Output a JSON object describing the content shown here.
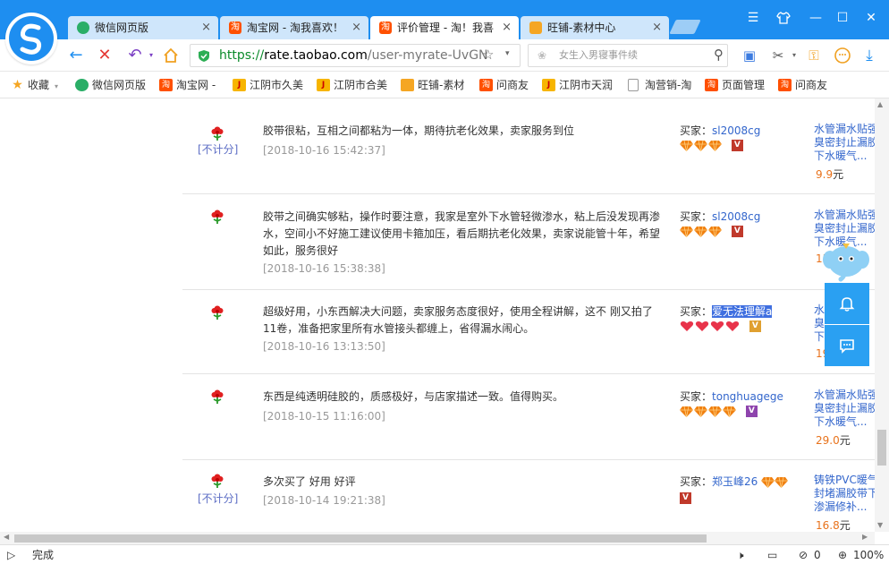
{
  "tabs": [
    {
      "title": "微信网页版",
      "icon": "wechat-icon",
      "close": "×"
    },
    {
      "title": "淘宝网 - 淘我喜欢！",
      "icon": "taobao-icon",
      "close": "×"
    },
    {
      "title": "评价管理 - 淘！我喜",
      "icon": "taobao-icon",
      "close": "×",
      "active": true
    },
    {
      "title": "旺铺-素材中心",
      "icon": "wangpu-icon",
      "close": "×"
    }
  ],
  "address": {
    "url_scheme": "https://",
    "url_host": "rate.taobao.com",
    "url_path": "/user-myrate-UvGN",
    "search_placeholder": "女生入男寝事件续"
  },
  "bookmarks": [
    {
      "label": "收藏",
      "icon": "star-icon"
    },
    {
      "label": "微信网页版",
      "icon": "wechat-icon"
    },
    {
      "label": "淘宝网 -",
      "icon": "taobao-icon"
    },
    {
      "label": "江阴市久美",
      "icon": "jiangyin-icon"
    },
    {
      "label": "江阴市合美",
      "icon": "jiangyin-icon"
    },
    {
      "label": "旺铺-素材",
      "icon": "wangpu-icon"
    },
    {
      "label": "问商友",
      "icon": "taobao-icon"
    },
    {
      "label": "江阴市天润",
      "icon": "jiangyin-icon"
    },
    {
      "label": "淘营销-淘",
      "icon": "page-icon"
    },
    {
      "label": "页面管理",
      "icon": "taobao-icon"
    },
    {
      "label": "问商友",
      "icon": "taobao-icon"
    }
  ],
  "reviews": [
    {
      "nocount": "[不计分]",
      "text": "胶带很粘，互相之间都粘为一体，期待抗老化效果，卖家服务到位",
      "date": "[2018-10-16 15:42:37]",
      "buyer_label": "买家：",
      "buyer_name": "sl2008cg",
      "item_lines": [
        "水管漏水贴强",
        "臭密封止漏胶",
        "下水暖气..."
      ],
      "price": "9.9",
      "price_unit": "元"
    },
    {
      "nocount": "",
      "text": "胶带之间确实够粘，操作时要注意，我家是室外下水管轻微渗水，粘上后没发现再渗水，空间小不好施工建议使用卡箍加压，看后期抗老化效果，卖家说能管十年，希望如此，服务很好",
      "date": "[2018-10-16 15:38:38]",
      "buyer_label": "买家：",
      "buyer_name": "sl2008cg",
      "item_lines": [
        "水管漏水贴强",
        "臭密封止漏胶",
        "下水暖气..."
      ],
      "price": "15",
      "price_unit": ""
    },
    {
      "nocount": "",
      "text": "超级好用，小东西解决大问题，卖家服务态度很好，使用全程讲解，这不 刚又拍了11卷，准备把家里所有水管接头都缠上，省得漏水闹心。",
      "date": "[2018-10-16 13:13:50]",
      "buyer_label": "买家：",
      "buyer_name": "爱无法理解a",
      "item_lines": [
        "水",
        "臭",
        "下"
      ],
      "price": "19",
      "price_unit": ""
    },
    {
      "nocount": "",
      "text": "东西是纯透明硅胶的，质感极好，与店家描述一致。值得购买。",
      "date": "[2018-10-15 11:16:00]",
      "buyer_label": "买家：",
      "buyer_name": "tonghuagege",
      "item_lines": [
        "水管漏水贴强",
        "臭密封止漏胶",
        "下水暖气..."
      ],
      "price": "29.0",
      "price_unit": "元"
    },
    {
      "nocount": "[不计分]",
      "text": "多次买了 好用 好评",
      "date": "[2018-10-14 19:21:38]",
      "buyer_label": "买家：",
      "buyer_name": "郑玉峰26",
      "item_lines": [
        "铸铁PVC暖气",
        "封堵漏胶带下",
        "渗漏修补..."
      ],
      "price": "16.8",
      "price_unit": "元"
    }
  ],
  "status": {
    "text": "完成",
    "download_count": "0",
    "zoom": "100%"
  },
  "colors": {
    "accent": "#1e8ef0",
    "link": "#3366cc",
    "price": "#e8721b",
    "float_button": "#2aa0f2"
  }
}
